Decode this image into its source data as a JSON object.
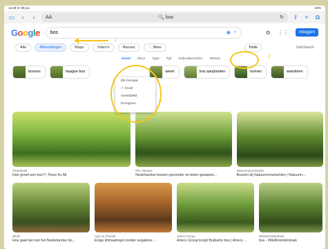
{
  "status": {
    "time": "12:29",
    "date": "Vr 30 jun.",
    "battery": "82%"
  },
  "browser": {
    "aa": "AA",
    "url": "bos"
  },
  "google": {
    "logo": "Google",
    "query": "bos",
    "login": "Inloggen"
  },
  "tabs": {
    "items": [
      "Alle",
      "Afbeeldingen",
      "Maps",
      "Video's",
      "Nieuws",
      "⋮ Meer"
    ],
    "tools": "Tools",
    "safesearch": "SafeSearch"
  },
  "filters": [
    "Groot",
    "Kleur",
    "Type",
    "Tijd",
    "Gebruiksrechten",
    "Wissen"
  ],
  "chips": [
    "bossen",
    "haagse bos",
    "weert",
    "bos aanplanten",
    "bomen",
    "wandelen"
  ],
  "dropdown": [
    "Elk formaat",
    "Groot",
    "Gemiddeld",
    "Pictogram"
  ],
  "annotations": [
    "1",
    "2",
    "3"
  ],
  "results": [
    {
      "src": "Treesforall",
      "title": "Hoe groeit een bos? | Trees for All"
    },
    {
      "src": "RTL Nieuws",
      "title": "Nederlandse bossen gezonder en beter gewapen..."
    },
    {
      "src": "Natuurmonumenten",
      "title": "Bossen bij Natuurmonumenten | Natuurm..."
    },
    {
      "src": "WUR",
      "title": "Hoe gaat het met het Nederlandse bo..."
    },
    {
      "src": "Agro & Chemie",
      "title": "Enige klimaatregel zonder negatieve ..."
    },
    {
      "src": "Arteco Group",
      "title": "Arteco Group koopt Brabants bos | Arteco ..."
    },
    {
      "src": "WikiWoordenboek",
      "title": "bos - WikiWoordenboek"
    }
  ],
  "colors": {
    "accent": "#1a73e8",
    "annotation": "#f4c51f"
  }
}
